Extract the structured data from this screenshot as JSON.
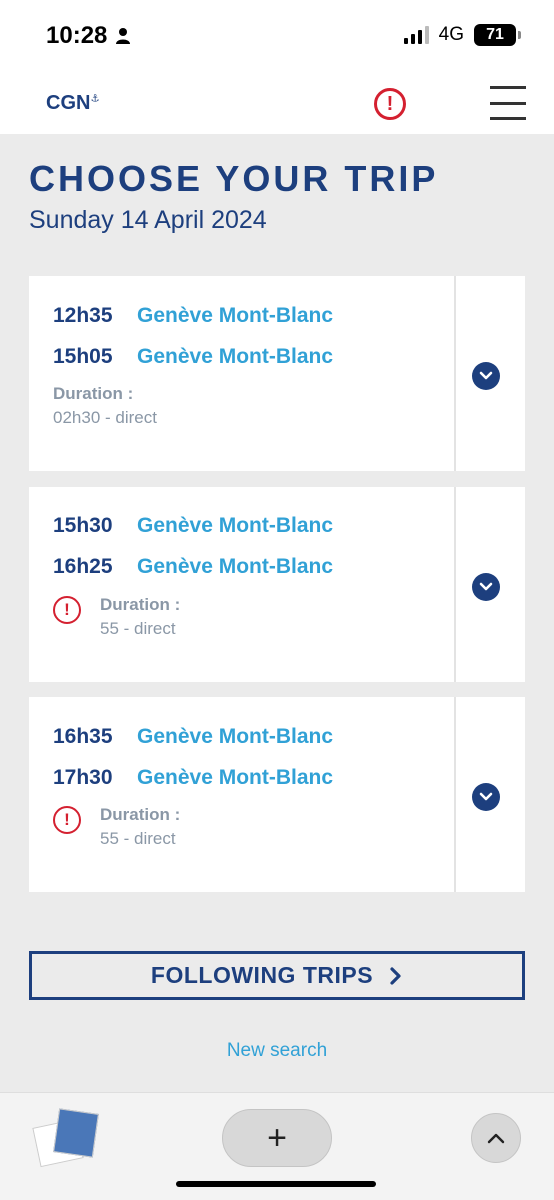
{
  "status_bar": {
    "time": "10:28",
    "network": "4G",
    "battery": "71"
  },
  "header": {
    "logo": "CGN",
    "logo_mark": "⚓",
    "alert_icon": "exclamation-circle-icon",
    "menu_icon": "hamburger-menu-icon"
  },
  "page": {
    "title": "CHOOSE YOUR TRIP",
    "date": "Sunday 14 April 2024"
  },
  "duration_label": "Duration :",
  "trips": [
    {
      "depart_time": "12h35",
      "depart_place": "Genève Mont-Blanc",
      "arrive_time": "15h05",
      "arrive_place": "Genève Mont-Blanc",
      "duration": "02h30 - direct",
      "warning": false
    },
    {
      "depart_time": "15h30",
      "depart_place": "Genève Mont-Blanc",
      "arrive_time": "16h25",
      "arrive_place": "Genève Mont-Blanc",
      "duration": "55 - direct",
      "warning": true
    },
    {
      "depart_time": "16h35",
      "depart_place": "Genève Mont-Blanc",
      "arrive_time": "17h30",
      "arrive_place": "Genève Mont-Blanc",
      "duration": "55 - direct",
      "warning": true
    }
  ],
  "actions": {
    "following_trips": "FOLLOWING TRIPS",
    "new_search": "New search"
  },
  "browser_bar": {
    "new_tab": "+"
  },
  "colors": {
    "navy": "#1d3f7e",
    "link_blue": "#31a1d6",
    "alert_red": "#d42030",
    "muted_gray": "#8a97a6",
    "background": "#ebebeb"
  }
}
